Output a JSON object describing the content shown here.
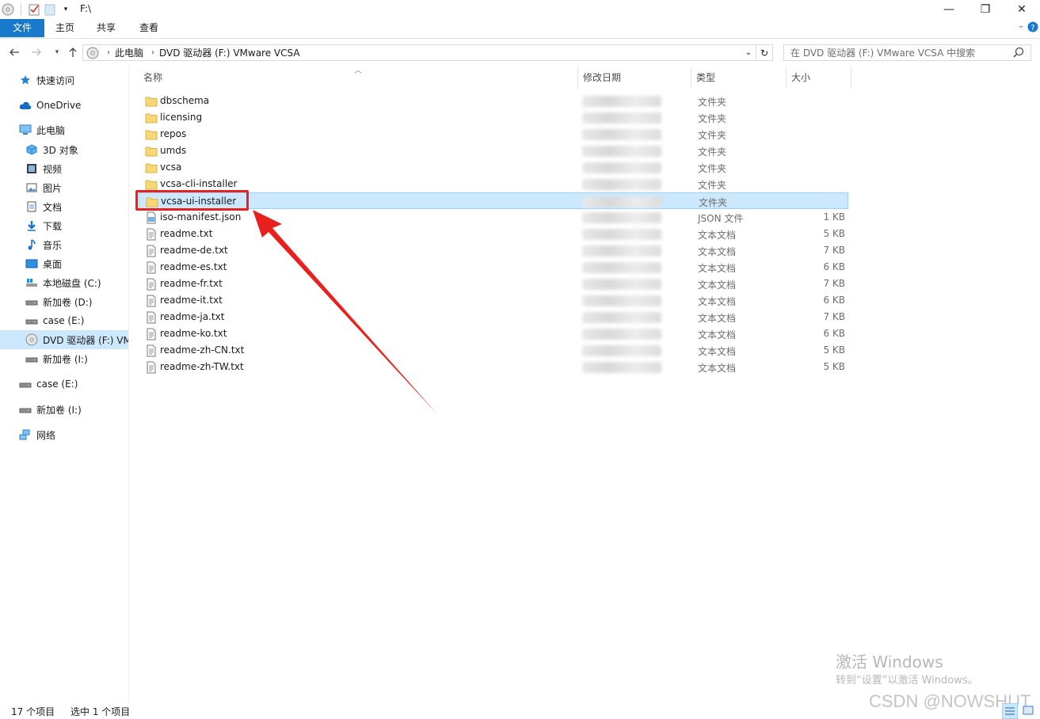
{
  "window": {
    "title": "F:\\"
  },
  "window_controls": {
    "minimize": "—",
    "maximize": "❐",
    "close": "✕"
  },
  "ribbon": {
    "tabs": [
      "文件",
      "主页",
      "共享",
      "查看"
    ]
  },
  "address": {
    "crumbs": [
      "此电脑",
      "DVD 驱动器 (F:) VMware VCSA"
    ],
    "search_placeholder": "在 DVD 驱动器 (F:) VMware VCSA 中搜索"
  },
  "sidebar": {
    "items": [
      {
        "label": "快速访问",
        "icon": "star-icon"
      },
      {
        "label": "OneDrive",
        "icon": "cloud-icon"
      },
      {
        "label": "此电脑",
        "icon": "computer-icon"
      },
      {
        "label": "3D 对象",
        "icon": "cube-icon"
      },
      {
        "label": "视频",
        "icon": "video-icon"
      },
      {
        "label": "图片",
        "icon": "picture-icon"
      },
      {
        "label": "文档",
        "icon": "document-icon"
      },
      {
        "label": "下载",
        "icon": "download-icon"
      },
      {
        "label": "音乐",
        "icon": "music-icon"
      },
      {
        "label": "桌面",
        "icon": "desktop-icon"
      },
      {
        "label": "本地磁盘 (C:)",
        "icon": "windows-drive-icon"
      },
      {
        "label": "新加卷 (D:)",
        "icon": "drive-icon"
      },
      {
        "label": "case (E:)",
        "icon": "drive-icon"
      },
      {
        "label": "DVD 驱动器 (F:) VMware VCSA",
        "icon": "dvd-icon"
      },
      {
        "label": "新加卷 (I:)",
        "icon": "drive-icon"
      },
      {
        "label": "case (E:)",
        "icon": "drive-icon"
      },
      {
        "label": "新加卷 (I:)",
        "icon": "drive-icon"
      },
      {
        "label": "网络",
        "icon": "network-icon"
      }
    ]
  },
  "columns": [
    "名称",
    "修改日期",
    "类型",
    "大小"
  ],
  "files": [
    {
      "name": "dbschema",
      "type": "文件夹",
      "size": "",
      "kind": "folder"
    },
    {
      "name": "licensing",
      "type": "文件夹",
      "size": "",
      "kind": "folder"
    },
    {
      "name": "repos",
      "type": "文件夹",
      "size": "",
      "kind": "folder"
    },
    {
      "name": "umds",
      "type": "文件夹",
      "size": "",
      "kind": "folder"
    },
    {
      "name": "vcsa",
      "type": "文件夹",
      "size": "",
      "kind": "folder"
    },
    {
      "name": "vcsa-cli-installer",
      "type": "文件夹",
      "size": "",
      "kind": "folder"
    },
    {
      "name": "vcsa-ui-installer",
      "type": "文件夹",
      "size": "",
      "kind": "folder"
    },
    {
      "name": "iso-manifest.json",
      "type": "JSON 文件",
      "size": "1 KB",
      "kind": "json"
    },
    {
      "name": "readme.txt",
      "type": "文本文档",
      "size": "5 KB",
      "kind": "txt"
    },
    {
      "name": "readme-de.txt",
      "type": "文本文档",
      "size": "7 KB",
      "kind": "txt"
    },
    {
      "name": "readme-es.txt",
      "type": "文本文档",
      "size": "6 KB",
      "kind": "txt"
    },
    {
      "name": "readme-fr.txt",
      "type": "文本文档",
      "size": "7 KB",
      "kind": "txt"
    },
    {
      "name": "readme-it.txt",
      "type": "文本文档",
      "size": "6 KB",
      "kind": "txt"
    },
    {
      "name": "readme-ja.txt",
      "type": "文本文档",
      "size": "7 KB",
      "kind": "txt"
    },
    {
      "name": "readme-ko.txt",
      "type": "文本文档",
      "size": "6 KB",
      "kind": "txt"
    },
    {
      "name": "readme-zh-CN.txt",
      "type": "文本文档",
      "size": "5 KB",
      "kind": "txt"
    },
    {
      "name": "readme-zh-TW.txt",
      "type": "文本文档",
      "size": "5 KB",
      "kind": "txt"
    }
  ],
  "status": {
    "count": "17 个项目",
    "selected": "选中 1 个项目"
  },
  "watermark": {
    "line1": "激活 Windows",
    "line2": "转到“设置”以激活 Windows。",
    "csdn": "CSDN @NOWSHUT"
  },
  "colors": {
    "selection": "#cce8ff",
    "accent": "#1979ca",
    "annotation": "#e8211f",
    "folder": "#f8d775"
  }
}
